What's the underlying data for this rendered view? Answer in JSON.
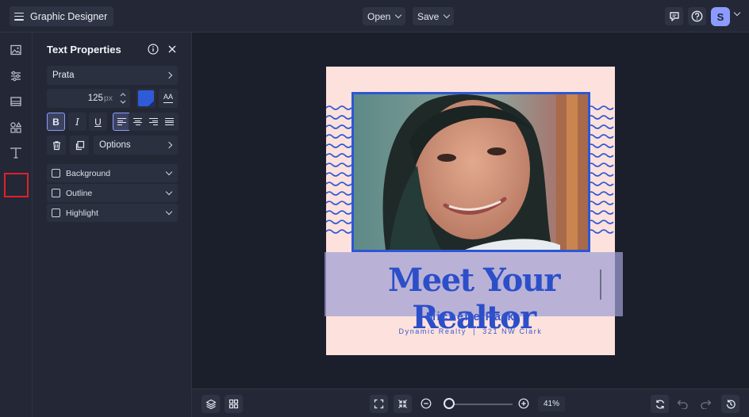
{
  "header": {
    "app_title": "Graphic Designer",
    "open_label": "Open",
    "save_label": "Save",
    "avatar_initial": "S"
  },
  "rail": {
    "items": [
      "image-icon",
      "sliders-icon",
      "layout-icon",
      "shapes-icon",
      "text-icon"
    ],
    "active": "text-icon"
  },
  "panel": {
    "title": "Text Properties",
    "font_name": "Prata",
    "font_size": "125",
    "font_unit": "px",
    "text_color": "#2f5bd8",
    "case_label": "AA",
    "bold_label": "B",
    "italic_label": "I",
    "underline_label": "U",
    "options_label": "Options",
    "toggles": {
      "background": "Background",
      "outline": "Outline",
      "highlight": "Highlight"
    }
  },
  "design": {
    "headline": "Meet Your Realtor",
    "name": "Michelle Park",
    "subline": "Dynamic Realty  |  321 NW Clark",
    "background_color": "#fde1dc",
    "accent_color": "#2c57d4"
  },
  "zoom": {
    "value_label": "41%",
    "level": 0.41
  }
}
